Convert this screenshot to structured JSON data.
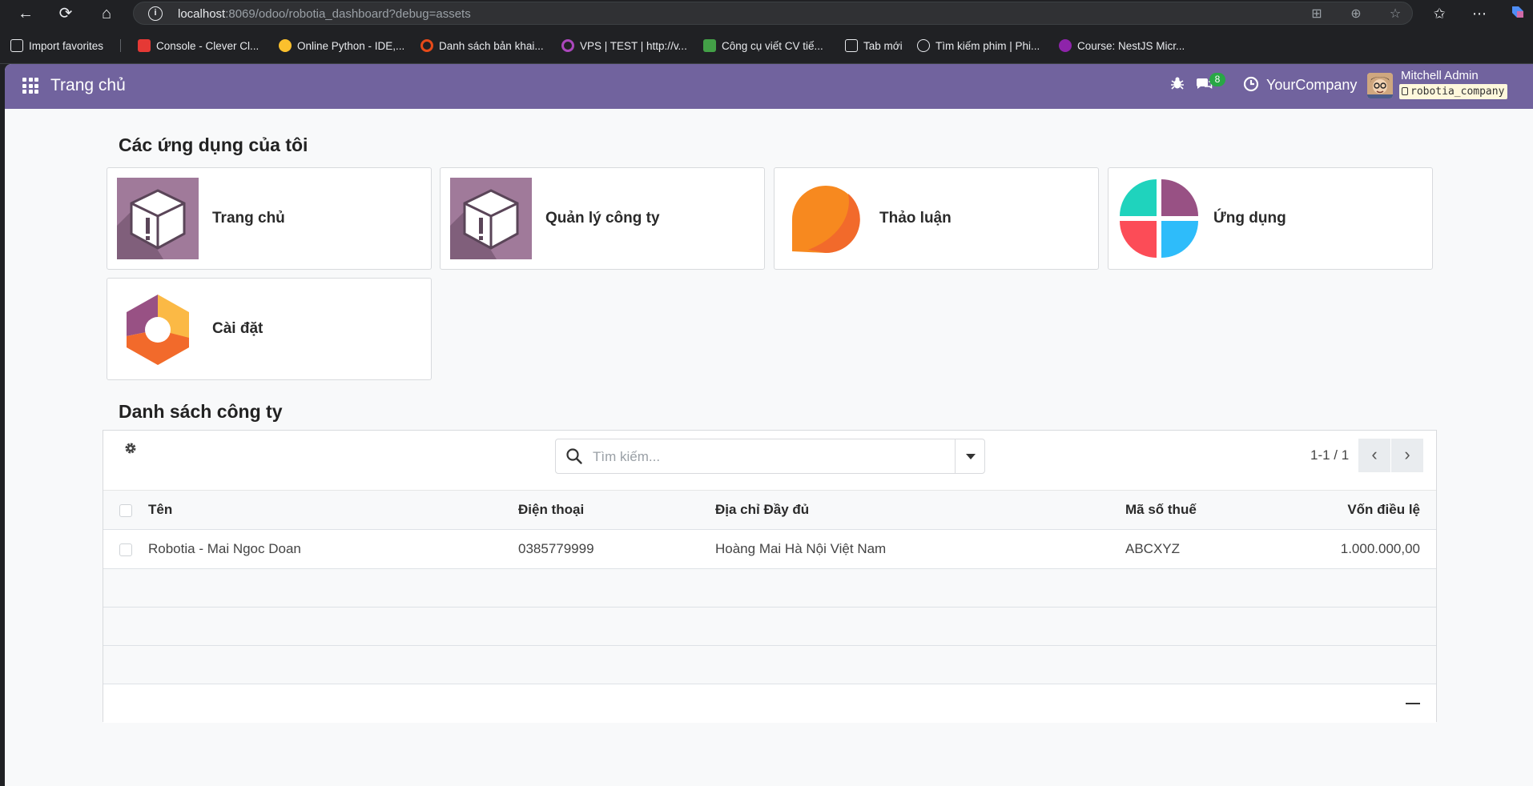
{
  "browser": {
    "url_host": "localhost",
    "url_rest": ":8069/odoo/robotia_dashboard?debug=assets",
    "bookmarks": [
      {
        "label": "Import favorites",
        "color": "#e8eaed"
      },
      {
        "label": "Console - Clever Cl...",
        "color": "#e53935"
      },
      {
        "label": "Online Python - IDE,...",
        "color": "#fbc02d"
      },
      {
        "label": "Danh sách bản khai...",
        "color": "#e64a19"
      },
      {
        "label": "VPS | TEST | http://v...",
        "color": "#ab47bc"
      },
      {
        "label": "Công cụ viết CV tiế...",
        "color": "#43a047"
      },
      {
        "label": "Tab mới",
        "color": "#e8eaed"
      },
      {
        "label": "Tìm kiếm phim | Phi...",
        "color": "#e8eaed"
      },
      {
        "label": "Course: NestJS Micr...",
        "color": "#8e24aa"
      }
    ]
  },
  "navbar": {
    "title": "Trang chủ",
    "message_count": "8",
    "company": "YourCompany",
    "user": "Mitchell Admin",
    "db": "robotia_company",
    "color": "#71639e"
  },
  "apps_section": {
    "title": "Các ứng dụng của tôi",
    "apps": [
      {
        "label": "Trang chủ",
        "icon": "box-warning-icon"
      },
      {
        "label": "Quản lý công ty",
        "icon": "box-warning-icon"
      },
      {
        "label": "Thảo luận",
        "icon": "discuss-bubble-icon"
      },
      {
        "label": "Ứng dụng",
        "icon": "apps-quad-icon"
      },
      {
        "label": "Cài đặt",
        "icon": "settings-hexagon-icon"
      }
    ]
  },
  "company_section": {
    "title": "Danh sách công ty",
    "search_placeholder": "Tìm kiếm...",
    "pager": "1-1 / 1",
    "columns": {
      "name": "Tên",
      "phone": "Điện thoại",
      "address": "Địa chỉ Đầy đủ",
      "tax": "Mã số thuế",
      "capital": "Vốn điều lệ"
    },
    "rows": [
      {
        "name": "Robotia - Mai Ngoc Doan",
        "phone": "0385779999",
        "address": "Hoàng Mai Hà Nội Việt Nam",
        "tax": "ABCXYZ",
        "capital": "1.000.000,00"
      }
    ]
  }
}
